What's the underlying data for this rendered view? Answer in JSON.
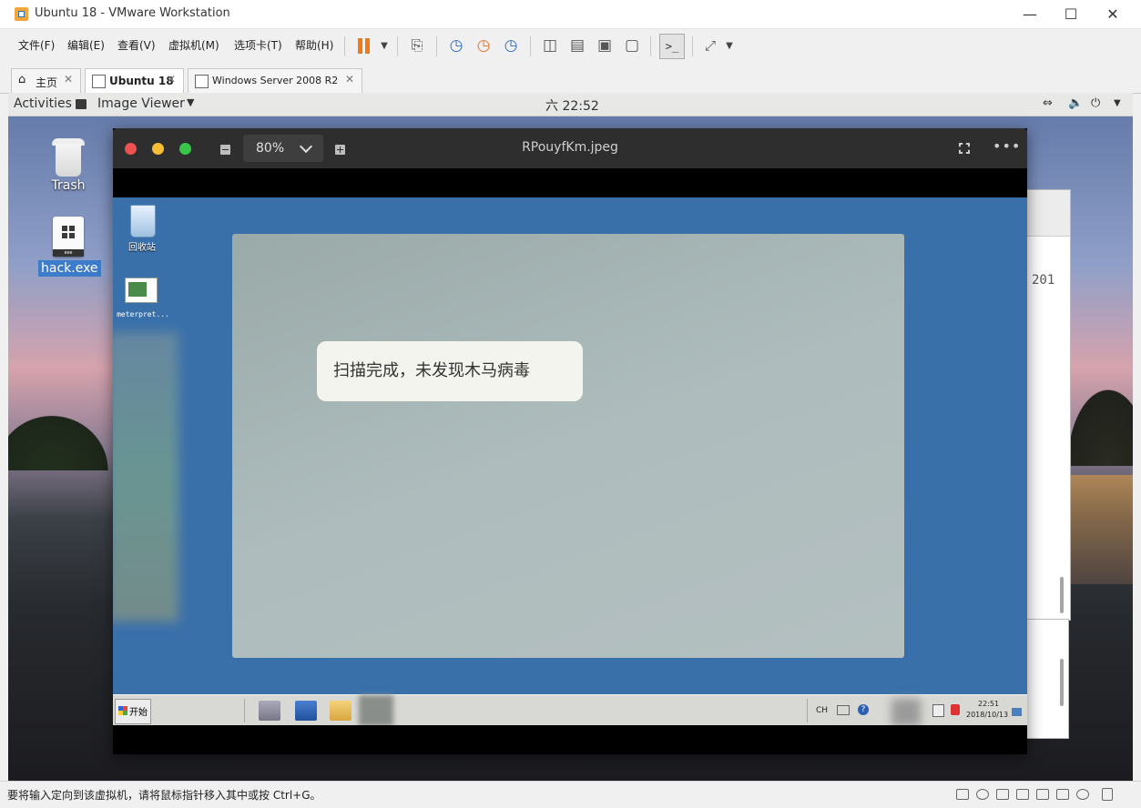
{
  "window": {
    "title": "Ubuntu 18 - VMware Workstation"
  },
  "menu": [
    "文件(F)",
    "编辑(E)",
    "查看(V)",
    "虚拟机(M)",
    "选项卡(T)",
    "帮助(H)"
  ],
  "tabs": [
    {
      "label": "主页",
      "active": false
    },
    {
      "label": "Ubuntu 18",
      "active": true
    },
    {
      "label": "Windows Server 2008 R2",
      "active": false
    }
  ],
  "gnome": {
    "activities": "Activities",
    "app_menu": "Image Viewer",
    "clock": "六 22:52"
  },
  "desktop": {
    "icons": [
      {
        "label": "Trash",
        "icon": "trash-icon"
      },
      {
        "label": "hack.exe",
        "icon": "exe-file-icon",
        "selected": true
      }
    ],
    "bg_window_text": "201"
  },
  "viewer": {
    "zoom": "80%",
    "file_name": "RPouyfKm.jpeg",
    "traffic_colors": [
      "#ee5152",
      "#f5be33",
      "#36c64a"
    ],
    "image": {
      "icons": [
        {
          "label": "回收站"
        },
        {
          "label": "meterpret..."
        }
      ],
      "message": "扫描完成，未发现木马病毒",
      "taskbar": {
        "start": "开始",
        "lang": "CH",
        "time": "22:51",
        "date": "2018/10/13"
      }
    }
  },
  "status": {
    "message": "要将输入定向到该虚拟机，请将鼠标指针移入其中或按 Ctrl+G。"
  }
}
